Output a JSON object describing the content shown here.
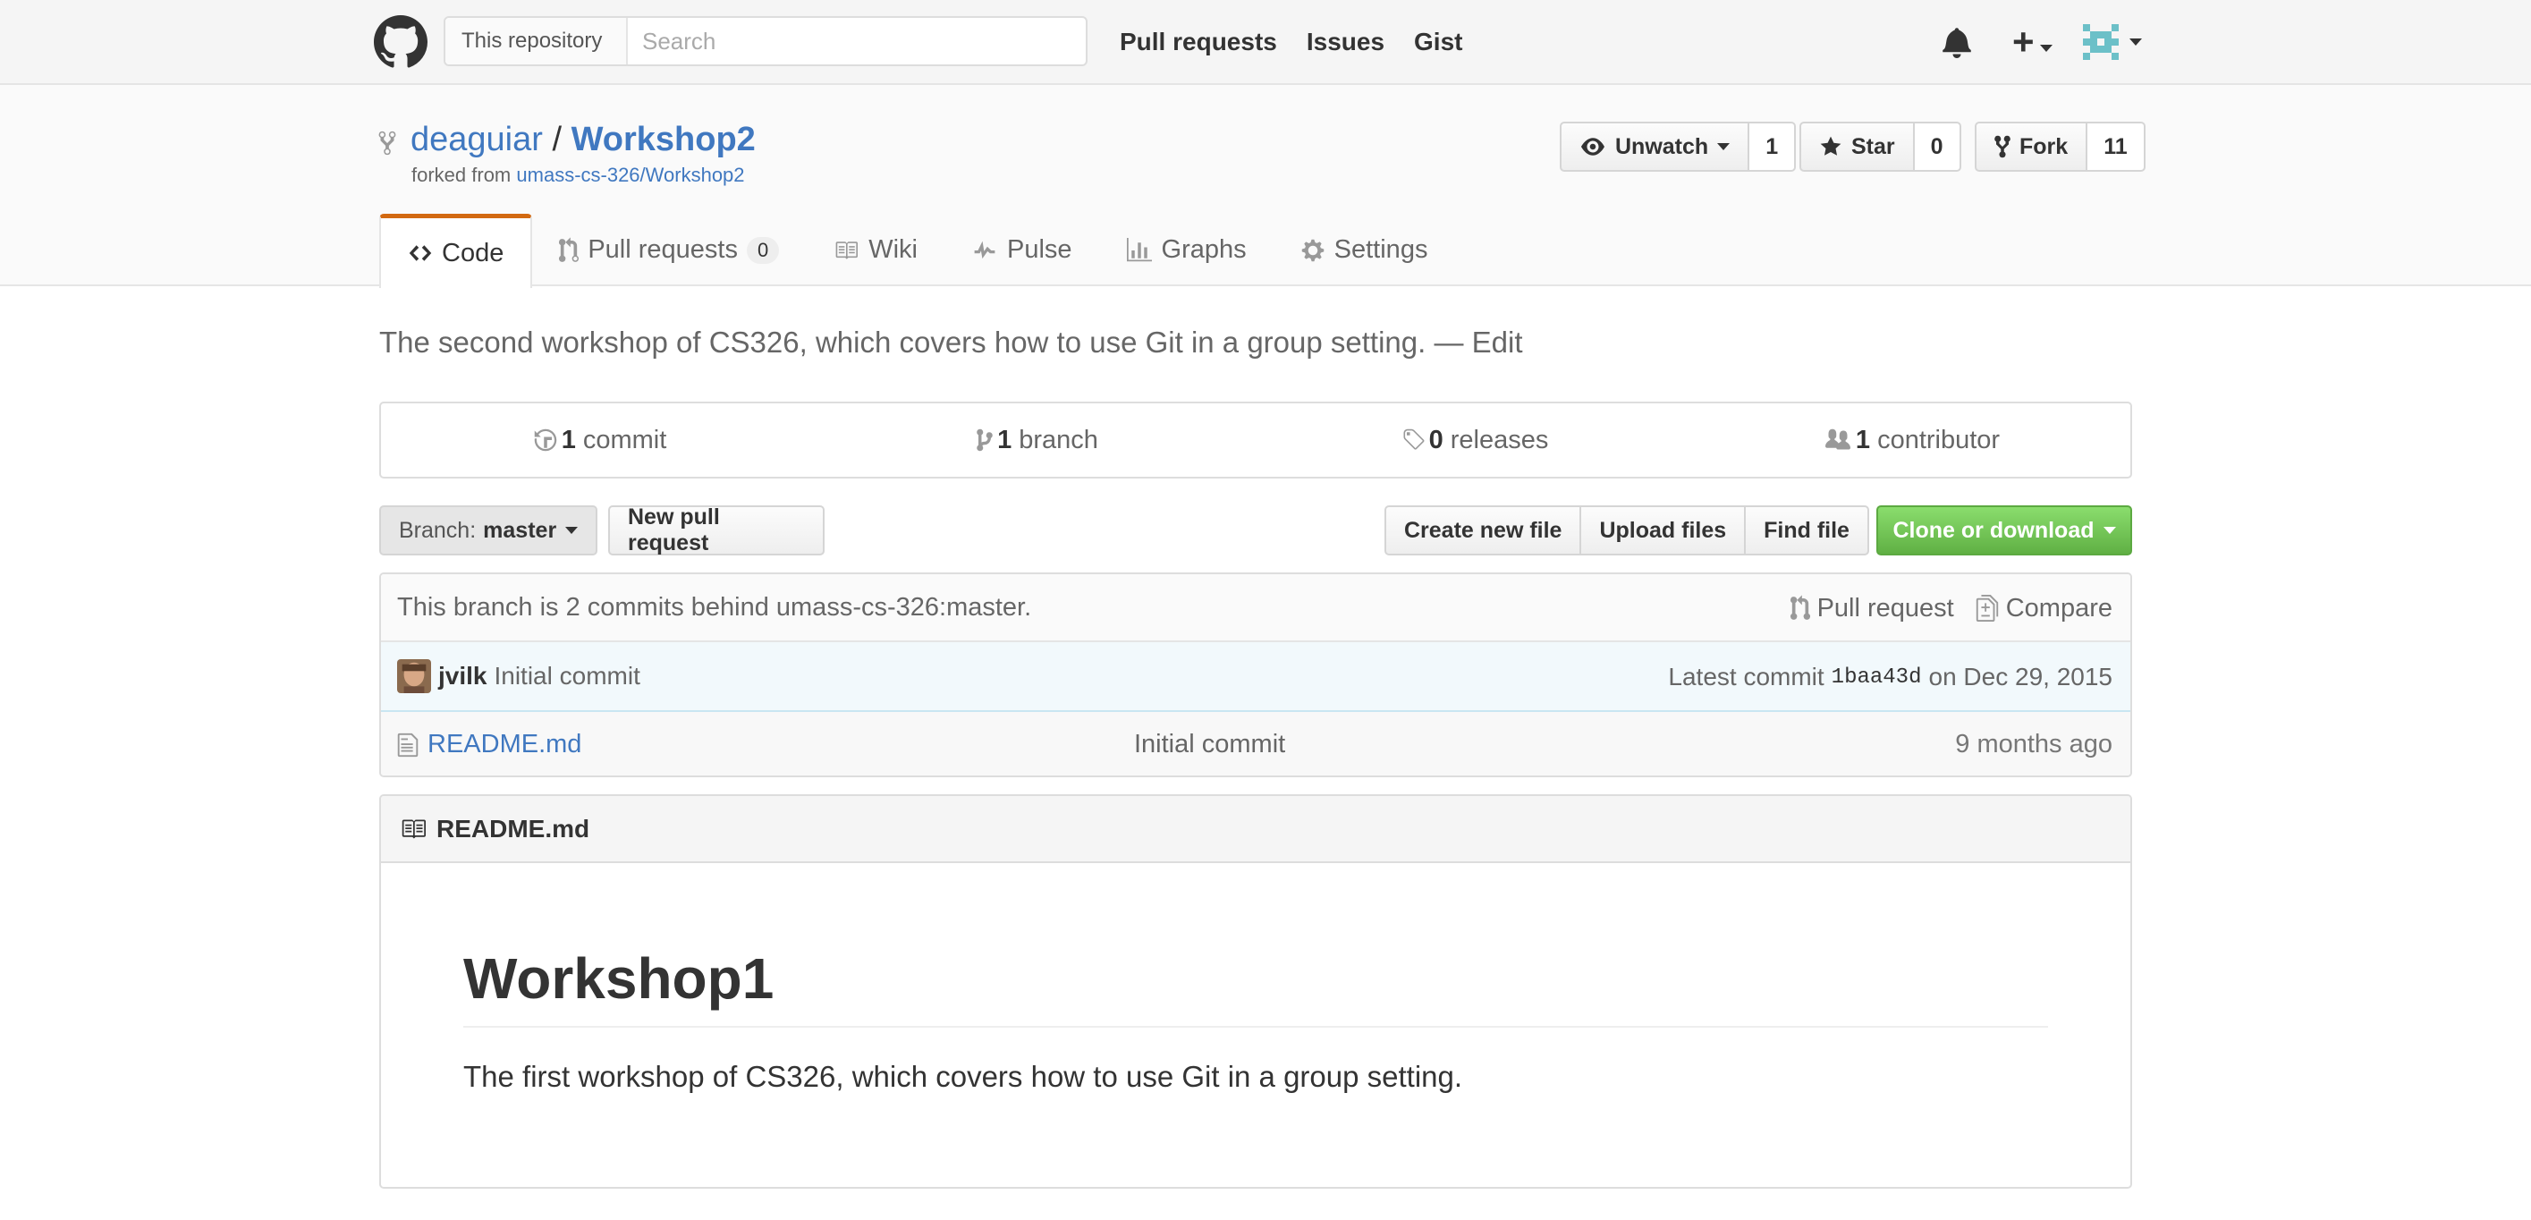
{
  "header": {
    "search_scope": "This repository",
    "search_placeholder": "Search",
    "nav": [
      "Pull requests",
      "Issues",
      "Gist"
    ],
    "plus_label": "+"
  },
  "repo": {
    "owner": "deaguiar",
    "separator": "/",
    "name": "Workshop2",
    "forked_from_label": "forked from",
    "forked_from_link": "umass-cs-326/Workshop2",
    "actions": {
      "watch_label": "Unwatch",
      "watch_count": "1",
      "star_label": "Star",
      "star_count": "0",
      "fork_label": "Fork",
      "fork_count": "11"
    },
    "tabs": [
      {
        "label": "Code",
        "icon": "code-icon"
      },
      {
        "label": "Pull requests",
        "counter": "0",
        "icon": "pull-request-icon"
      },
      {
        "label": "Wiki",
        "icon": "book-icon"
      },
      {
        "label": "Pulse",
        "icon": "pulse-icon"
      },
      {
        "label": "Graphs",
        "icon": "graph-icon"
      },
      {
        "label": "Settings",
        "icon": "gear-icon"
      }
    ]
  },
  "description": {
    "text": "The second workshop of CS326, which covers how to use Git in a group setting.",
    "edit_separator": "—",
    "edit_label": "Edit"
  },
  "summary": {
    "commits_count": "1",
    "commits_label": "commit",
    "branches_count": "1",
    "branches_label": "branch",
    "releases_count": "0",
    "releases_label": "releases",
    "contributors_count": "1",
    "contributors_label": "contributor"
  },
  "filenav": {
    "branch_prefix": "Branch:",
    "branch_name": "master",
    "new_pr": "New pull request",
    "create_file": "Create new file",
    "upload_files": "Upload files",
    "find_file": "Find file",
    "clone": "Clone or download"
  },
  "infobar": {
    "text": "This branch is 2 commits behind umass-cs-326:master.",
    "pull_request": "Pull request",
    "compare": "Compare"
  },
  "commit": {
    "author": "jvilk",
    "message": "Initial commit",
    "latest_label": "Latest commit",
    "sha": "1baa43d",
    "date": "on Dec 29, 2015"
  },
  "files": [
    {
      "name": "README.md",
      "message": "Initial commit",
      "age": "9 months ago"
    }
  ],
  "readme": {
    "filename": "README.md",
    "heading": "Workshop1",
    "body": "The first workshop of CS326, which covers how to use Git in a group setting."
  },
  "colors": {
    "accent": "#4078c0",
    "tab_highlight": "#d26911",
    "green_button": "#60b044",
    "commit_bar": "#f2f9fc"
  }
}
